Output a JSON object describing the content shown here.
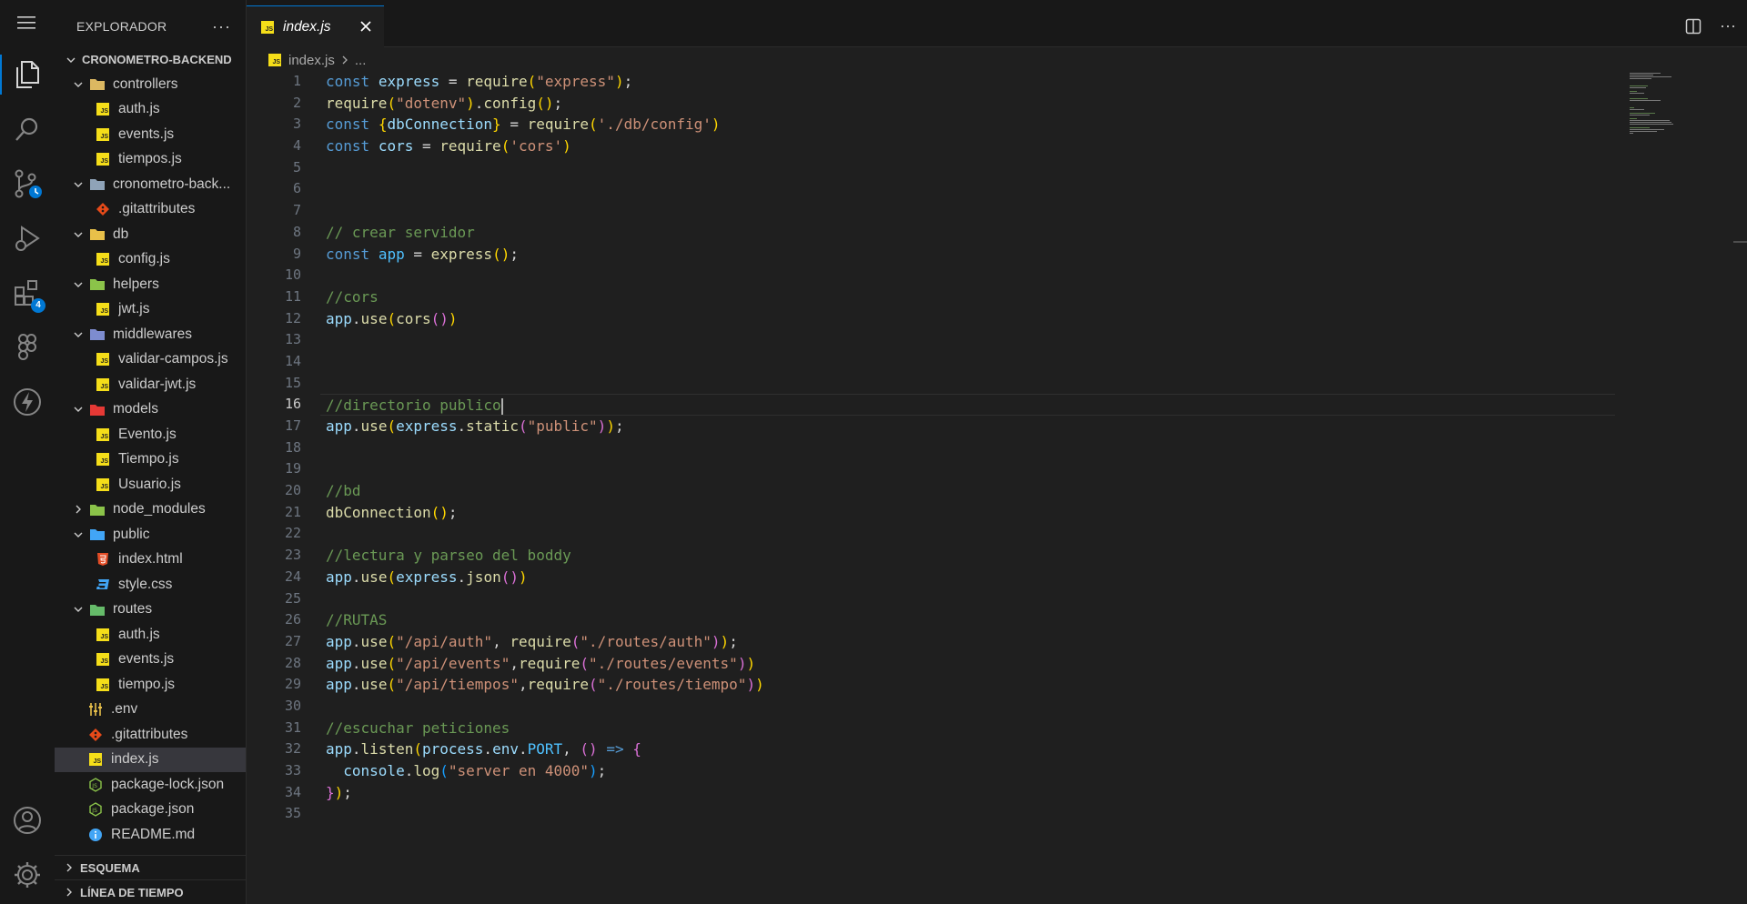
{
  "activity_bar": {
    "extensions_badge": "4"
  },
  "sidebar": {
    "title": "EXPLORADOR",
    "more": "···",
    "root": "CRONOMETRO-BACKEND",
    "items": [
      {
        "label": "controllers",
        "type": "folder",
        "depth": 1,
        "open": true,
        "color": "#dcb862"
      },
      {
        "label": "auth.js",
        "type": "js",
        "depth": 2
      },
      {
        "label": "events.js",
        "type": "js",
        "depth": 2
      },
      {
        "label": "tiempos.js",
        "type": "js",
        "depth": 2
      },
      {
        "label": "cronometro-back...",
        "type": "folder",
        "depth": 1,
        "open": true,
        "color": "#8fa3b8"
      },
      {
        "label": ".gitattributes",
        "type": "git",
        "depth": 2
      },
      {
        "label": "db",
        "type": "folder",
        "depth": 1,
        "open": true,
        "color": "#e8c04a"
      },
      {
        "label": "config.js",
        "type": "js",
        "depth": 2
      },
      {
        "label": "helpers",
        "type": "folder",
        "depth": 1,
        "open": true,
        "color": "#8bc34a"
      },
      {
        "label": "jwt.js",
        "type": "js",
        "depth": 2
      },
      {
        "label": "middlewares",
        "type": "folder",
        "depth": 1,
        "open": true,
        "color": "#7e8ccf"
      },
      {
        "label": "validar-campos.js",
        "type": "js",
        "depth": 2
      },
      {
        "label": "validar-jwt.js",
        "type": "js",
        "depth": 2
      },
      {
        "label": "models",
        "type": "folder",
        "depth": 1,
        "open": true,
        "color": "#e53935"
      },
      {
        "label": "Evento.js",
        "type": "js",
        "depth": 2
      },
      {
        "label": "Tiempo.js",
        "type": "js",
        "depth": 2
      },
      {
        "label": "Usuario.js",
        "type": "js",
        "depth": 2
      },
      {
        "label": "node_modules",
        "type": "folder",
        "depth": 1,
        "open": false,
        "color": "#8bc34a"
      },
      {
        "label": "public",
        "type": "folder",
        "depth": 1,
        "open": true,
        "color": "#42a5f5"
      },
      {
        "label": "index.html",
        "type": "html",
        "depth": 2
      },
      {
        "label": "style.css",
        "type": "css",
        "depth": 2
      },
      {
        "label": "routes",
        "type": "folder",
        "depth": 1,
        "open": true,
        "color": "#66bb6a"
      },
      {
        "label": "auth.js",
        "type": "js",
        "depth": 2
      },
      {
        "label": "events.js",
        "type": "js",
        "depth": 2
      },
      {
        "label": "tiempo.js",
        "type": "js",
        "depth": 2
      },
      {
        "label": ".env",
        "type": "env",
        "depth": 1
      },
      {
        "label": ".gitattributes",
        "type": "git",
        "depth": 1
      },
      {
        "label": "index.js",
        "type": "js",
        "depth": 1,
        "selected": true
      },
      {
        "label": "package-lock.json",
        "type": "json",
        "depth": 1
      },
      {
        "label": "package.json",
        "type": "json",
        "depth": 1
      },
      {
        "label": "README.md",
        "type": "info",
        "depth": 1
      }
    ],
    "outline": "ESQUEMA",
    "timeline": "LÍNEA DE TIEMPO"
  },
  "tab": {
    "label": "index.js",
    "icon_text": "JS"
  },
  "breadcrumb": {
    "file": "index.js",
    "tail": "..."
  },
  "editor": {
    "current_line": 16,
    "lines": [
      [
        [
          "kw",
          "const"
        ],
        [
          "op",
          " "
        ],
        [
          "var",
          "express"
        ],
        [
          "op",
          " = "
        ],
        [
          "fn",
          "require"
        ],
        [
          "p1",
          "("
        ],
        [
          "str",
          "\"express\""
        ],
        [
          "p1",
          ")"
        ],
        [
          "op",
          ";"
        ]
      ],
      [
        [
          "fn",
          "require"
        ],
        [
          "p1",
          "("
        ],
        [
          "str",
          "\"dotenv\""
        ],
        [
          "p1",
          ")"
        ],
        [
          "op",
          "."
        ],
        [
          "fn",
          "config"
        ],
        [
          "p1",
          "()"
        ],
        [
          "op",
          ";"
        ]
      ],
      [
        [
          "kw",
          "const"
        ],
        [
          "op",
          " "
        ],
        [
          "p1",
          "{"
        ],
        [
          "var",
          "dbConnection"
        ],
        [
          "p1",
          "}"
        ],
        [
          "op",
          " = "
        ],
        [
          "fn",
          "require"
        ],
        [
          "p1",
          "("
        ],
        [
          "str",
          "'./db/config'"
        ],
        [
          "p1",
          ")"
        ]
      ],
      [
        [
          "kw",
          "const"
        ],
        [
          "op",
          " "
        ],
        [
          "var",
          "cors"
        ],
        [
          "op",
          " = "
        ],
        [
          "fn",
          "require"
        ],
        [
          "p1",
          "("
        ],
        [
          "str",
          "'cors'"
        ],
        [
          "p1",
          ")"
        ]
      ],
      [],
      [],
      [],
      [
        [
          "com",
          "// crear servidor"
        ]
      ],
      [
        [
          "kw",
          "const"
        ],
        [
          "op",
          " "
        ],
        [
          "cst",
          "app"
        ],
        [
          "op",
          " = "
        ],
        [
          "fn",
          "express"
        ],
        [
          "p1",
          "()"
        ],
        [
          "op",
          ";"
        ]
      ],
      [],
      [
        [
          "com",
          "//cors"
        ]
      ],
      [
        [
          "var",
          "app"
        ],
        [
          "op",
          "."
        ],
        [
          "fn",
          "use"
        ],
        [
          "p1",
          "("
        ],
        [
          "fn",
          "cors"
        ],
        [
          "p2",
          "()"
        ],
        [
          "p1",
          ")"
        ]
      ],
      [],
      [],
      [],
      [
        [
          "com",
          "//directorio publico"
        ]
      ],
      [
        [
          "var",
          "app"
        ],
        [
          "op",
          "."
        ],
        [
          "fn",
          "use"
        ],
        [
          "p1",
          "("
        ],
        [
          "var",
          "express"
        ],
        [
          "op",
          "."
        ],
        [
          "fn",
          "static"
        ],
        [
          "p2",
          "("
        ],
        [
          "str",
          "\"public\""
        ],
        [
          "p2",
          ")"
        ],
        [
          "p1",
          ")"
        ],
        [
          "op",
          ";"
        ]
      ],
      [],
      [],
      [
        [
          "com",
          "//bd"
        ]
      ],
      [
        [
          "fn",
          "dbConnection"
        ],
        [
          "p1",
          "()"
        ],
        [
          "op",
          ";"
        ]
      ],
      [],
      [
        [
          "com",
          "//lectura y parseo del boddy"
        ]
      ],
      [
        [
          "var",
          "app"
        ],
        [
          "op",
          "."
        ],
        [
          "fn",
          "use"
        ],
        [
          "p1",
          "("
        ],
        [
          "var",
          "express"
        ],
        [
          "op",
          "."
        ],
        [
          "fn",
          "json"
        ],
        [
          "p2",
          "()"
        ],
        [
          "p1",
          ")"
        ]
      ],
      [],
      [
        [
          "com",
          "//RUTAS"
        ]
      ],
      [
        [
          "var",
          "app"
        ],
        [
          "op",
          "."
        ],
        [
          "fn",
          "use"
        ],
        [
          "p1",
          "("
        ],
        [
          "str",
          "\"/api/auth\""
        ],
        [
          "op",
          ", "
        ],
        [
          "fn",
          "require"
        ],
        [
          "p2",
          "("
        ],
        [
          "str",
          "\"./routes/auth\""
        ],
        [
          "p2",
          ")"
        ],
        [
          "p1",
          ")"
        ],
        [
          "op",
          ";"
        ]
      ],
      [
        [
          "var",
          "app"
        ],
        [
          "op",
          "."
        ],
        [
          "fn",
          "use"
        ],
        [
          "p1",
          "("
        ],
        [
          "str",
          "\"/api/events\""
        ],
        [
          "op",
          ","
        ],
        [
          "fn",
          "require"
        ],
        [
          "p2",
          "("
        ],
        [
          "str",
          "\"./routes/events\""
        ],
        [
          "p2",
          ")"
        ],
        [
          "p1",
          ")"
        ]
      ],
      [
        [
          "var",
          "app"
        ],
        [
          "op",
          "."
        ],
        [
          "fn",
          "use"
        ],
        [
          "p1",
          "("
        ],
        [
          "str",
          "\"/api/tiempos\""
        ],
        [
          "op",
          ","
        ],
        [
          "fn",
          "require"
        ],
        [
          "p2",
          "("
        ],
        [
          "str",
          "\"./routes/tiempo\""
        ],
        [
          "p2",
          ")"
        ],
        [
          "p1",
          ")"
        ]
      ],
      [],
      [
        [
          "com",
          "//escuchar peticiones"
        ]
      ],
      [
        [
          "var",
          "app"
        ],
        [
          "op",
          "."
        ],
        [
          "fn",
          "listen"
        ],
        [
          "p1",
          "("
        ],
        [
          "var",
          "process"
        ],
        [
          "op",
          "."
        ],
        [
          "var",
          "env"
        ],
        [
          "op",
          "."
        ],
        [
          "cst",
          "PORT"
        ],
        [
          "op",
          ", "
        ],
        [
          "p2",
          "()"
        ],
        [
          "op",
          " "
        ],
        [
          "kw",
          "=>"
        ],
        [
          "op",
          " "
        ],
        [
          "p2",
          "{"
        ]
      ],
      [
        [
          "op",
          "  "
        ],
        [
          "var",
          "console"
        ],
        [
          "op",
          "."
        ],
        [
          "fn",
          "log"
        ],
        [
          "p3",
          "("
        ],
        [
          "str",
          "\"server en 4000\""
        ],
        [
          "p3",
          ")"
        ],
        [
          "op",
          ";"
        ]
      ],
      [
        [
          "p2",
          "}"
        ],
        [
          "p1",
          ")"
        ],
        [
          "op",
          ";"
        ]
      ],
      []
    ]
  }
}
